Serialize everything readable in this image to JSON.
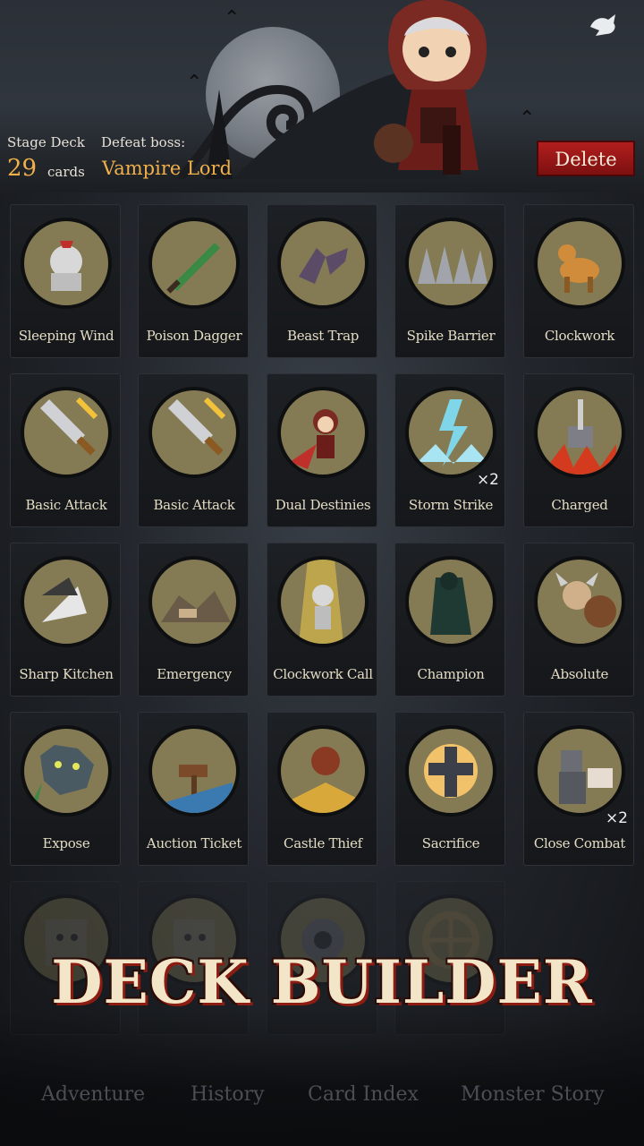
{
  "header": {
    "stage_deck_label": "Stage Deck",
    "defeat_label": "Defeat boss:",
    "card_count": "29",
    "card_count_unit": "cards",
    "boss_name": "Vampire Lord",
    "delete_label": "Delete"
  },
  "cards": [
    {
      "name": "Sleeping Wind",
      "icon": "knight-sleeping-icon"
    },
    {
      "name": "Poison Dagger",
      "icon": "dagger-icon"
    },
    {
      "name": "Beast Trap",
      "icon": "trap-icon"
    },
    {
      "name": "Spike Barrier",
      "icon": "spikes-icon"
    },
    {
      "name": "Clockwork",
      "icon": "toy-horse-icon"
    },
    {
      "name": "Basic Attack",
      "icon": "sword-icon"
    },
    {
      "name": "Basic Attack",
      "icon": "sword-icon"
    },
    {
      "name": "Dual Destinies",
      "icon": "hooded-girl-icon"
    },
    {
      "name": "Storm Strike",
      "icon": "lightning-icon",
      "count": "×2"
    },
    {
      "name": "Charged",
      "icon": "hammer-icon"
    },
    {
      "name": "Sharp Kitchen",
      "icon": "knife-icon"
    },
    {
      "name": "Emergency",
      "icon": "rubble-icon"
    },
    {
      "name": "Clockwork Call",
      "icon": "knight-light-icon"
    },
    {
      "name": "Champion",
      "icon": "cloak-icon"
    },
    {
      "name": "Absolute",
      "icon": "viking-icon"
    },
    {
      "name": "Expose",
      "icon": "wolf-icon"
    },
    {
      "name": "Auction Ticket",
      "icon": "gavel-icon"
    },
    {
      "name": "Castle Thief",
      "icon": "thief-icon"
    },
    {
      "name": "Sacrifice",
      "icon": "cross-icon"
    },
    {
      "name": "Close Combat",
      "icon": "armored-knight-icon",
      "count": "×2"
    },
    {
      "name": "",
      "icon": "tablet-icon"
    },
    {
      "name": "",
      "icon": "tablet-icon"
    },
    {
      "name": "",
      "icon": "gear-icon"
    },
    {
      "name": "",
      "icon": "wheel-icon"
    }
  ],
  "banner": "DECK BUILDER",
  "tabs": [
    "Adventure",
    "History",
    "Card Index",
    "Monster Story"
  ]
}
